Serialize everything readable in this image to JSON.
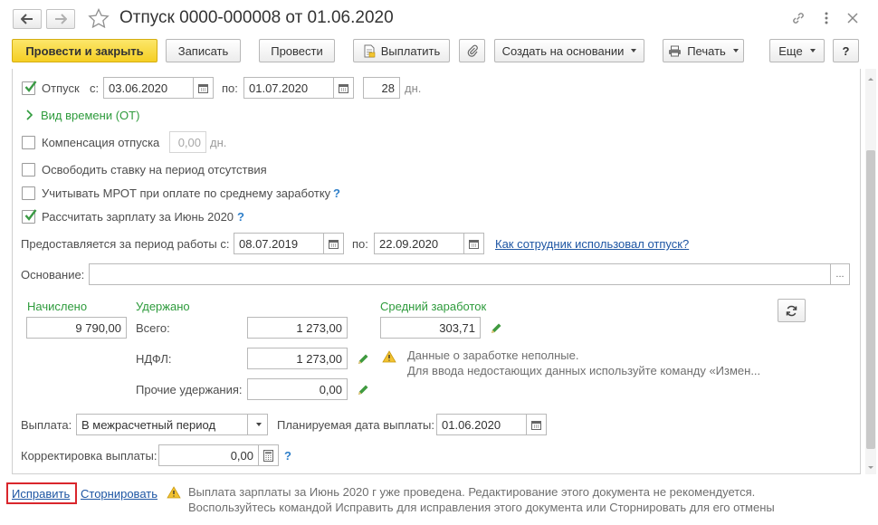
{
  "window": {
    "title": "Отпуск 0000-000008 от 01.06.2020"
  },
  "toolbar": {
    "post_close": "Провести и закрыть",
    "save": "Записать",
    "post": "Провести",
    "pay": "Выплатить",
    "create_based": "Создать на основании",
    "print": "Печать",
    "more": "Еще",
    "help": "?"
  },
  "vacation": {
    "label": "Отпуск",
    "checked": true,
    "from_label": "с:",
    "from_value": "03.06.2020",
    "to_label": "по:",
    "to_value": "01.07.2020",
    "days_value": "28",
    "days_unit": "дн."
  },
  "time_type_link": "Вид времени (ОТ)",
  "compensation": {
    "label": "Компенсация отпуска",
    "value": "0,00",
    "unit": "дн."
  },
  "release_rate_label": "Освободить ставку на период отсутствия",
  "mrot_label": "Учитывать МРОТ при оплате по среднему заработку",
  "calc_salary_label": "Рассчитать зарплату за Июнь 2020",
  "period": {
    "label": "Предоставляется за период работы с:",
    "from_value": "08.07.2019",
    "to_label": "по:",
    "to_value": "22.09.2020",
    "link": "Как сотрудник использовал отпуск?"
  },
  "basis": {
    "label": "Основание:",
    "value": "",
    "button": "..."
  },
  "accrued": {
    "header": "Начислено",
    "value": "9 790,00"
  },
  "withheld": {
    "header": "Удержано",
    "total_label": "Всего:",
    "total_value": "1 273,00",
    "ndfl_label": "НДФЛ:",
    "ndfl_value": "1 273,00",
    "other_label": "Прочие удержания:",
    "other_value": "0,00"
  },
  "average": {
    "header": "Средний заработок",
    "value": "303,71",
    "warning_line1": "Данные о заработке неполные.",
    "warning_line2": "Для ввода недостающих данных используйте команду «Измен..."
  },
  "payout": {
    "label": "Выплата:",
    "value": "В межрасчетный период",
    "planned_label": "Планируемая дата выплаты:",
    "planned_value": "01.06.2020"
  },
  "correction": {
    "label": "Корректировка выплаты:",
    "value": "0,00"
  },
  "footer": {
    "fix_link": "Исправить",
    "reverse_link": "Сторнировать",
    "warning_line1": "Выплата зарплаты за Июнь 2020 г уже проведена. Редактирование этого документа не рекомендуется.",
    "warning_line2": "Воспользуйтесь командой Исправить для исправления этого документа или Сторнировать для его отмены"
  },
  "help_mark": "?",
  "colors": {
    "primary_button": "#f5cf24",
    "green_text": "#2e9b3c",
    "link": "#1d55a3",
    "highlight_box": "#d9262c"
  }
}
